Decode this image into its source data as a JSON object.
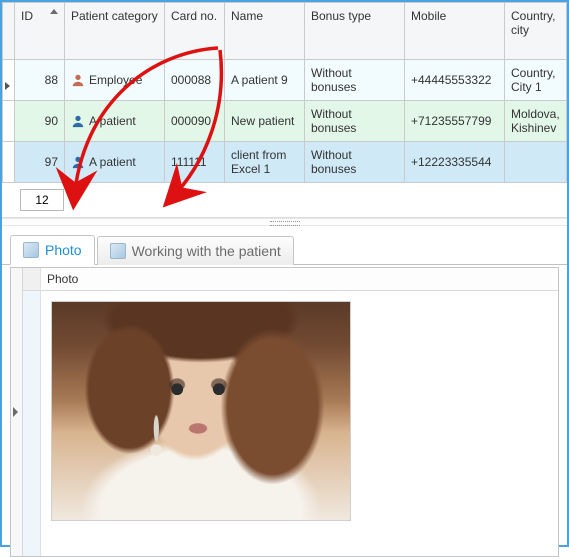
{
  "grid": {
    "columns": [
      "ID",
      "Patient category",
      "Card no.",
      "Name",
      "Bonus type",
      "Mobile",
      "Country, city"
    ],
    "sort_col": 0,
    "rows": [
      {
        "id": "88",
        "cat_icon": "employee-icon",
        "category": "Employee",
        "card": "000088",
        "name": "A patient 9",
        "bonus": "Without bonuses",
        "mobile": "+44445553322",
        "place": "Country, City 1"
      },
      {
        "id": "90",
        "cat_icon": "patient-icon",
        "category": "A patient",
        "card": "000090",
        "name": "New patient",
        "bonus": "Without bonuses",
        "mobile": "+71235557799",
        "place": "Moldova, Kishinev"
      },
      {
        "id": "97",
        "cat_icon": "patient-icon",
        "category": "A patient",
        "card": "111111",
        "name": "client from Excel 1",
        "bonus": "Without bonuses",
        "mobile": "+12223335544",
        "place": ""
      }
    ]
  },
  "pager": {
    "value": "12"
  },
  "tabs": {
    "items": [
      {
        "label": "Photo",
        "active": true
      },
      {
        "label": "Working with the patient",
        "active": false
      }
    ]
  },
  "panel": {
    "title": "Photo"
  }
}
